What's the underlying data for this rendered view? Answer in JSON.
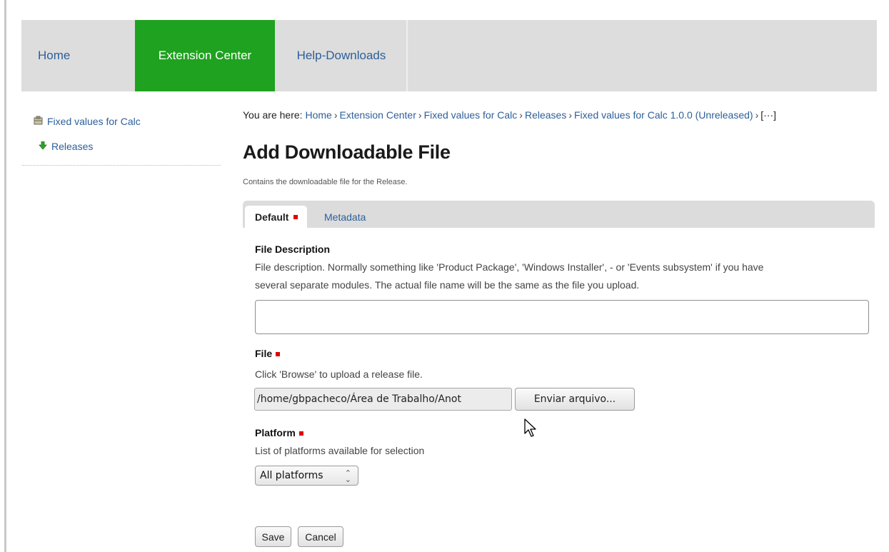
{
  "nav": {
    "home": "Home",
    "extension_center": "Extension Center",
    "help_downloads": "Help-Downloads",
    "active_color": "#1fa21f"
  },
  "sidebar": {
    "items": [
      {
        "label": "Fixed values for Calc",
        "icon": "package-icon"
      },
      {
        "label": "Releases",
        "icon": "arrow-down-icon"
      }
    ]
  },
  "breadcrumb": {
    "prefix": "You are here:",
    "items": [
      "Home",
      "Extension Center",
      "Fixed values for Calc",
      "Releases",
      "Fixed values for Calc 1.0.0 (Unreleased)",
      "[···]"
    ],
    "separator": "›"
  },
  "page": {
    "title": "Add Downloadable File",
    "description": "Contains the downloadable file for the Release."
  },
  "tabs": [
    {
      "label": "Default",
      "active": true
    },
    {
      "label": "Metadata",
      "active": false
    }
  ],
  "form": {
    "file_description": {
      "label": "File Description",
      "help_line1": "File description. Normally something like 'Product Package', 'Windows Installer', - or 'Events subsystem' if you have",
      "help_line2": "several separate modules. The actual file name will be the same as the file you upload.",
      "value": ""
    },
    "file": {
      "label": "File",
      "help": "Click 'Browse' to upload a release file.",
      "value": "/home/gbpacheco/Área de Trabalho/Anot",
      "button": "Enviar arquivo..."
    },
    "platform": {
      "label": "Platform",
      "help": "List of platforms available for selection",
      "selected": "All platforms"
    },
    "save": "Save",
    "cancel": "Cancel"
  }
}
